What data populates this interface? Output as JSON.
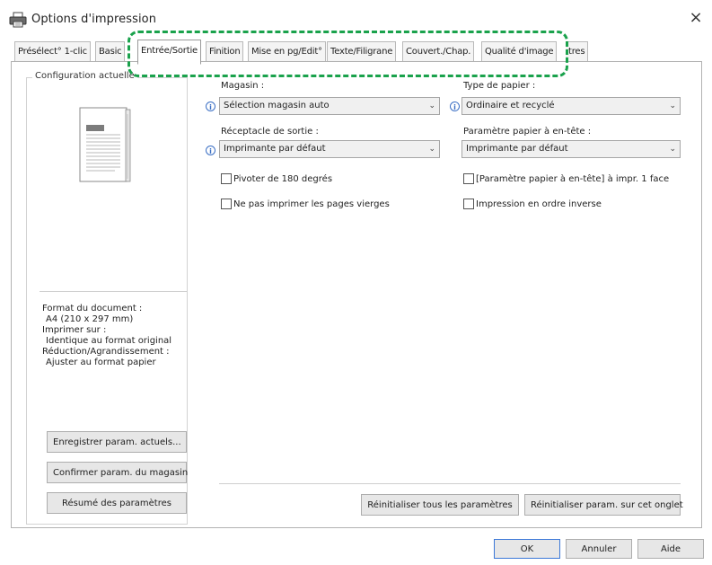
{
  "window": {
    "title": "Options d'impression",
    "close_glyph": "×"
  },
  "tabs": [
    {
      "label": "Présélect° 1-clic",
      "active": false
    },
    {
      "label": "Basic",
      "active": false
    },
    {
      "label": "Entrée/Sortie",
      "active": true
    },
    {
      "label": "Finition",
      "active": false
    },
    {
      "label": "Mise en pg/Edit°",
      "active": false
    },
    {
      "label": "Texte/Filigrane",
      "active": false
    },
    {
      "label": "Couvert./Chap.",
      "active": false
    },
    {
      "label": "Qualité d'image",
      "active": false
    },
    {
      "label": "tres",
      "active": false
    }
  ],
  "left_panel": {
    "title": "Configuration actuelle",
    "info_lines": [
      "Format du document :",
      "  A4 (210 x 297 mm)",
      "Imprimer sur :",
      "  Identique au format original",
      "Réduction/Agrandissement :",
      "  Ajuster au format papier"
    ],
    "buttons": [
      "Enregistrer param. actuels...",
      "Confirmer param. du magasin",
      "Résumé des paramètres"
    ]
  },
  "fields": {
    "magasin": {
      "label": "Magasin :",
      "value": "Sélection magasin auto"
    },
    "type_papier": {
      "label": "Type de papier :",
      "value": "Ordinaire et recyclé"
    },
    "receptacle": {
      "label": "Réceptacle de sortie :",
      "value": "Imprimante par défaut"
    },
    "param_entete": {
      "label": "Paramètre papier à en-tête :",
      "value": "Imprimante par défaut"
    }
  },
  "checkboxes": [
    {
      "label": "Pivoter de 180 degrés",
      "checked": false
    },
    {
      "label": "[Paramètre papier à en-tête] à impr. 1 face",
      "checked": false
    },
    {
      "label": "Ne pas imprimer les pages vierges",
      "checked": false
    },
    {
      "label": "Impression en ordre inverse",
      "checked": false
    }
  ],
  "reset_buttons": {
    "all": "Réinitialiser tous les paramètres",
    "tab": "Réinitialiser param. sur cet onglet"
  },
  "footer": {
    "ok": "OK",
    "cancel": "Annuler",
    "help": "Aide"
  },
  "icons": {
    "printer": "printer-icon",
    "info": "i",
    "chevron": "⌄"
  },
  "colors": {
    "highlight": "#1aa24c",
    "info": "#3b6fc4"
  }
}
